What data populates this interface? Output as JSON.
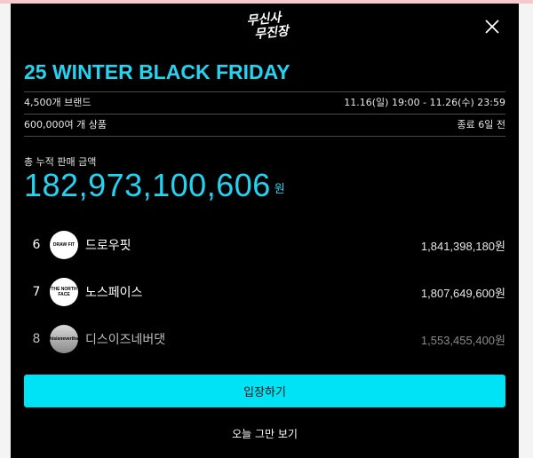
{
  "modal": {
    "logo_line1": "무신사",
    "logo_line2": "무진장",
    "title": "25 WINTER BLACK FRIDAY",
    "brand_count": "4,500개 브랜드",
    "period": "11.16(일) 19:00 - 11.26(수) 23:59",
    "product_count": "600,000여 개 상품",
    "ends_in": "종료 6일 전",
    "total_sales_label": "총 누적 판매 금액",
    "total_sales": "182,973,100,606",
    "total_sales_unit": "원",
    "ranking": [
      {
        "rank": "6",
        "logo_text": "DRAW FIT",
        "name": "드로우핏",
        "sales": "1,841,398,180원"
      },
      {
        "rank": "7",
        "logo_text": "THE NORTH FACE",
        "name": "노스페이스",
        "sales": "1,807,649,600원"
      },
      {
        "rank": "8",
        "logo_text": "thisisneverthat",
        "name": "디스이즈네버댓",
        "sales": "1,553,455,400원"
      }
    ],
    "enter_label": "입장하기",
    "dismiss_today_label": "오늘 그만 보기"
  },
  "colors": {
    "accent": "#21d4f2",
    "button": "#00e3f7",
    "background": "#000000"
  },
  "icons": {
    "close": "close-icon"
  }
}
